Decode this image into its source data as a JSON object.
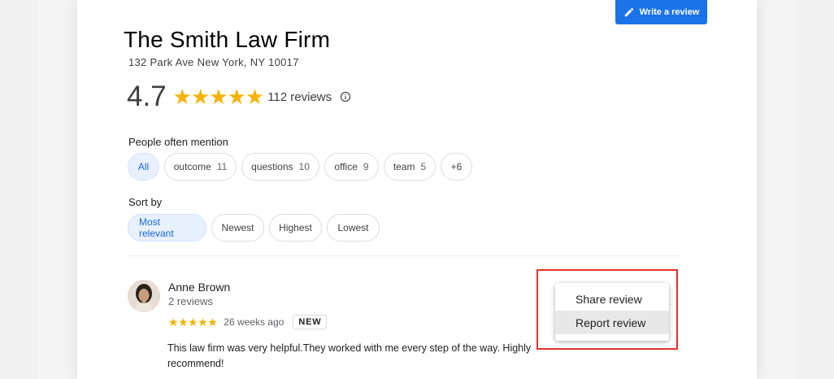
{
  "header": {
    "write_review_label": "Write a review"
  },
  "business": {
    "name": "The Smith Law Firm",
    "address": "132 Park Ave New York, NY 10017",
    "rating": "4.7",
    "stars": "★★★★★",
    "review_count": "112 reviews"
  },
  "mentions": {
    "label": "People often mention",
    "chips": [
      {
        "label": "All",
        "count": ""
      },
      {
        "label": "outcome",
        "count": "11"
      },
      {
        "label": "questions",
        "count": "10"
      },
      {
        "label": "office",
        "count": "9"
      },
      {
        "label": "team",
        "count": "5"
      },
      {
        "label": "+6",
        "count": ""
      }
    ],
    "selected": "All"
  },
  "sort": {
    "label": "Sort by",
    "options": [
      "Most relevant",
      "Newest",
      "Highest",
      "Lowest"
    ],
    "selected": "Most relevant"
  },
  "review": {
    "author": "Anne Brown",
    "author_reviews": "2 reviews",
    "stars": "★★★★★",
    "time": "26 weeks ago",
    "badge": "NEW",
    "text": "This law firm was very helpful.They worked with me every step of the way. Highly recommend!"
  },
  "menu": {
    "items": [
      "Share review",
      "Report review"
    ],
    "hovered": "Report review"
  },
  "colors": {
    "accent": "#1a73e8",
    "star": "#f5b301",
    "highlight": "#e4322b",
    "chip_active_bg": "#e8f0fe"
  },
  "icons": {
    "write": "pencil-icon",
    "info": "info-icon",
    "avatar": "avatar"
  }
}
